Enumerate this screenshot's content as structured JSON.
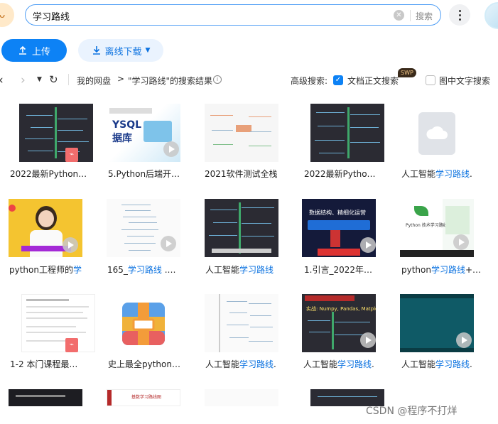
{
  "search": {
    "query": "学习路线",
    "button": "搜索"
  },
  "actions": {
    "upload": "上传",
    "offline": "离线下载"
  },
  "breadcrumb": {
    "root": "我的网盘",
    "arrow": ">",
    "result": "\"学习路线\"的搜索结果"
  },
  "advanced": {
    "label": "高级搜索:",
    "fulltext": "文档正文搜索",
    "image_text": "图中文字搜索",
    "badge": "SWP"
  },
  "files": [
    {
      "name": "2022最新Python…",
      "prefix": "2022最新Python…",
      "highlight": "",
      "suffix": ""
    },
    {
      "name": "5.Python后端开…",
      "prefix": "5.Python后端开…",
      "highlight": "",
      "suffix": ""
    },
    {
      "name": "2021软件测试全栈",
      "prefix": "2021软件测试全栈",
      "highlight": "",
      "suffix": ""
    },
    {
      "name": "2022最新Pytho…",
      "prefix": "2022最新Pytho…",
      "highlight": "",
      "suffix": ""
    },
    {
      "name": "人工智能学习路线.",
      "prefix": "人工智能",
      "highlight": "学习路线",
      "suffix": "."
    },
    {
      "name": "python工程师的学…",
      "prefix": "python工程师的",
      "highlight": "学",
      "suffix": ""
    },
    {
      "name": "165_学习路线 .…",
      "prefix": "165_",
      "highlight": "学习路线",
      "suffix": " .…"
    },
    {
      "name": "人工智能学习路线",
      "prefix": "人工智能",
      "highlight": "学习路线",
      "suffix": ""
    },
    {
      "name": "1.引言_2022年…",
      "prefix": "1.引言_2022年…",
      "highlight": "",
      "suffix": ""
    },
    {
      "name": "python学习路线+…",
      "prefix": "python",
      "highlight": "学习路线",
      "suffix": "+…"
    },
    {
      "name": "1-2 本门课程最…",
      "prefix": "1-2 本门课程最…",
      "highlight": "",
      "suffix": ""
    },
    {
      "name": "史上最全python…",
      "prefix": "史上最全python…",
      "highlight": "",
      "suffix": ""
    },
    {
      "name": "人工智能学习路线.",
      "prefix": "人工智能",
      "highlight": "学习路线",
      "suffix": "."
    },
    {
      "name": "人工智能学习路线.",
      "prefix": "人工智能",
      "highlight": "学习路线",
      "suffix": "."
    },
    {
      "name": "人工智能学习路线.",
      "prefix": "人工智能",
      "highlight": "学习路线",
      "suffix": "."
    }
  ],
  "thumb_text": {
    "t2_title": "YSQL",
    "t2_sub": "据库",
    "t10_title": "Python 技术学习路线",
    "t17_title": "基数学习路线图",
    "t14_title": "实战: Numpy, Pandas, Matplo",
    "t9_title": "数据结构、精细化运营"
  },
  "watermark": "CSDN @程序不打烊"
}
